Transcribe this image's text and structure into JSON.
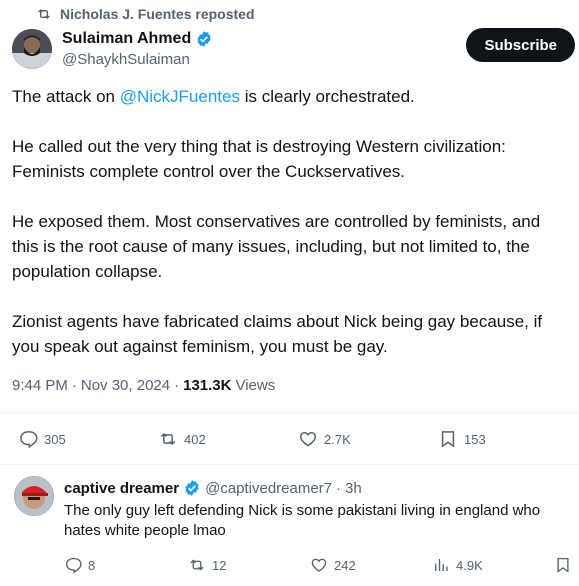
{
  "repost": {
    "label": "Nicholas J. Fuentes reposted"
  },
  "author": {
    "name": "Sulaiman Ahmed",
    "handle": "@ShaykhSulaiman"
  },
  "subscribe_label": "Subscribe",
  "tweet": {
    "p1_before": "The attack on ",
    "p1_mention": "@NickJFuentes",
    "p1_after": " is clearly orchestrated.",
    "p2_line1": "He called out the very thing that is destroying Western civilization:",
    "p2_line2": "Feminists complete control over the Cuckservatives.",
    "p3_line1": "He exposed them. Most conservatives are controlled by feminists, and",
    "p3_line2": "this is the root cause of many issues, including, but not limited to, the",
    "p3_line3": "population collapse.",
    "p4_line1": "Zionist agents have fabricated claims about Nick being gay because, if",
    "p4_line2": "you speak out against feminism, you must be gay."
  },
  "meta": {
    "time": "9:44 PM",
    "date": "Nov 30, 2024",
    "sep": "·",
    "views": "131.3K",
    "views_label": "Views"
  },
  "actions": {
    "replies": "305",
    "reposts": "402",
    "likes": "2.7K",
    "bookmarks": "153"
  },
  "reply": {
    "name": "captive dreamer",
    "handle": "@captivedreamer7",
    "sep": "·",
    "time": "3h",
    "text": "The only guy left defending Nick is some pakistani living in england who hates white people lmao",
    "actions": {
      "replies": "8",
      "reposts": "12",
      "likes": "242",
      "views": "4.9K"
    }
  },
  "colors": {
    "accent": "#1d9bf0",
    "text": "#0f1419",
    "muted": "#536471"
  }
}
